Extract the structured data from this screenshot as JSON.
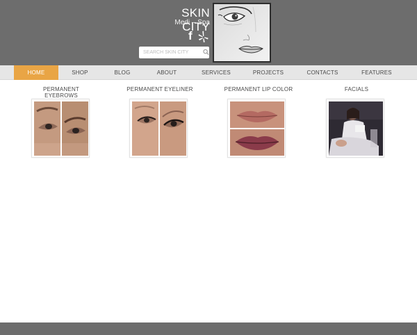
{
  "brand": {
    "title": "SKIN CITY",
    "subtitle": "Medi – Spa"
  },
  "social": {
    "facebook_glyph": "f",
    "icons": [
      "facebook-icon",
      "yelp-icon"
    ]
  },
  "search": {
    "placeholder": "SEARCH SKIN CITY"
  },
  "nav": {
    "items": [
      {
        "label": "HOME",
        "active": true
      },
      {
        "label": "SHOP"
      },
      {
        "label": "BLOG"
      },
      {
        "label": "ABOUT"
      },
      {
        "label": "SERVICES"
      },
      {
        "label": "PROJECTS"
      },
      {
        "label": "CONTACTS"
      },
      {
        "label": "FEATURES"
      }
    ]
  },
  "services": [
    {
      "title": "PERMANENT EYEBROWS"
    },
    {
      "title": "PERMANENT EYELINER"
    },
    {
      "title": "PERMANENT LIP COLOR"
    },
    {
      "title": "FACIALS"
    }
  ],
  "colors": {
    "header": "#6d6d6d",
    "nav_active": "#e9a545",
    "nav_bg": "#e6e6e6"
  }
}
